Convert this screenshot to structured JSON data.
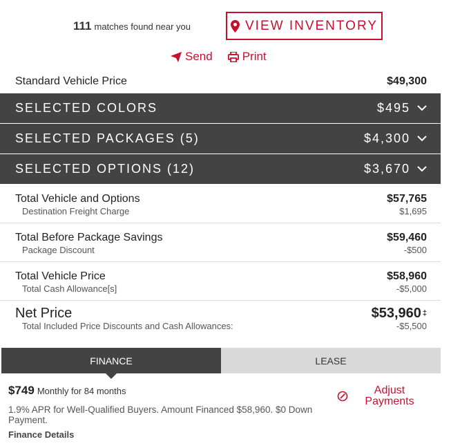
{
  "header": {
    "match_count": "111",
    "match_text": "matches found near you",
    "inventory_button": "VIEW INVENTORY"
  },
  "actions": {
    "send": "Send",
    "print": "Print"
  },
  "standard": {
    "label": "Standard Vehicle Price",
    "value": "$49,300"
  },
  "sections": [
    {
      "label": "SELECTED COLORS",
      "value": "$495"
    },
    {
      "label": "SELECTED PACKAGES (5)",
      "value": "$4,300"
    },
    {
      "label": "SELECTED OPTIONS (12)",
      "value": "$3,670"
    }
  ],
  "totals": [
    {
      "label": "Total Vehicle and Options",
      "value": "$57,765",
      "sub_label": "Destination Freight Charge",
      "sub_value": "$1,695"
    },
    {
      "label": "Total Before Package Savings",
      "value": "$59,460",
      "sub_label": "Package Discount",
      "sub_value": "-$500"
    },
    {
      "label": "Total Vehicle Price",
      "value": "$58,960",
      "sub_label": "Total Cash Allowance[s]",
      "sub_value": "-$5,000"
    }
  ],
  "net": {
    "label": "Net Price",
    "value": "$53,960",
    "marker": "‡",
    "sub_label": "Total Included Price Discounts and Cash Allowances:",
    "sub_value": "-$5,500"
  },
  "tabs": {
    "finance": "FINANCE",
    "lease": "LEASE"
  },
  "finance": {
    "amount": "$749",
    "period": "Monthly for 84 months",
    "terms": "1.9% APR for Well-Qualified Buyers. Amount Financed $58,960. $0 Down Payment.",
    "details_link": "Finance Details",
    "adjust_label": "Adjust Payments"
  },
  "colors": {
    "accent": "#c8102e",
    "band": "#434343",
    "tab_inactive": "#d9d9d9"
  },
  "icons": [
    "map-marker-icon",
    "send-icon",
    "print-icon",
    "chevron-down-icon",
    "adjust-icon"
  ]
}
